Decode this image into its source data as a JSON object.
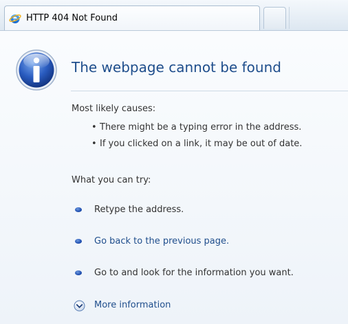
{
  "tab": {
    "title": "HTTP 404 Not Found",
    "icon": "internet-explorer-icon",
    "new_tab_icon": "new-tab-icon"
  },
  "page": {
    "icon": "info-icon",
    "title": "The webpage cannot be found",
    "causes_heading": "Most likely causes:",
    "causes": [
      "There might be a typing error in the address.",
      "If you clicked on a link, it may be out of date."
    ],
    "try_heading": "What you can try:",
    "try_items": [
      "Retype the address.",
      "Go back to the previous page.",
      "Go to  and look for the information you want."
    ],
    "more_info": "More information"
  },
  "colors": {
    "title_blue": "#1f4e8c",
    "link_blue": "#1f4e8c",
    "text_gray": "#333333",
    "bullet_blue": "#1f4fb0"
  }
}
